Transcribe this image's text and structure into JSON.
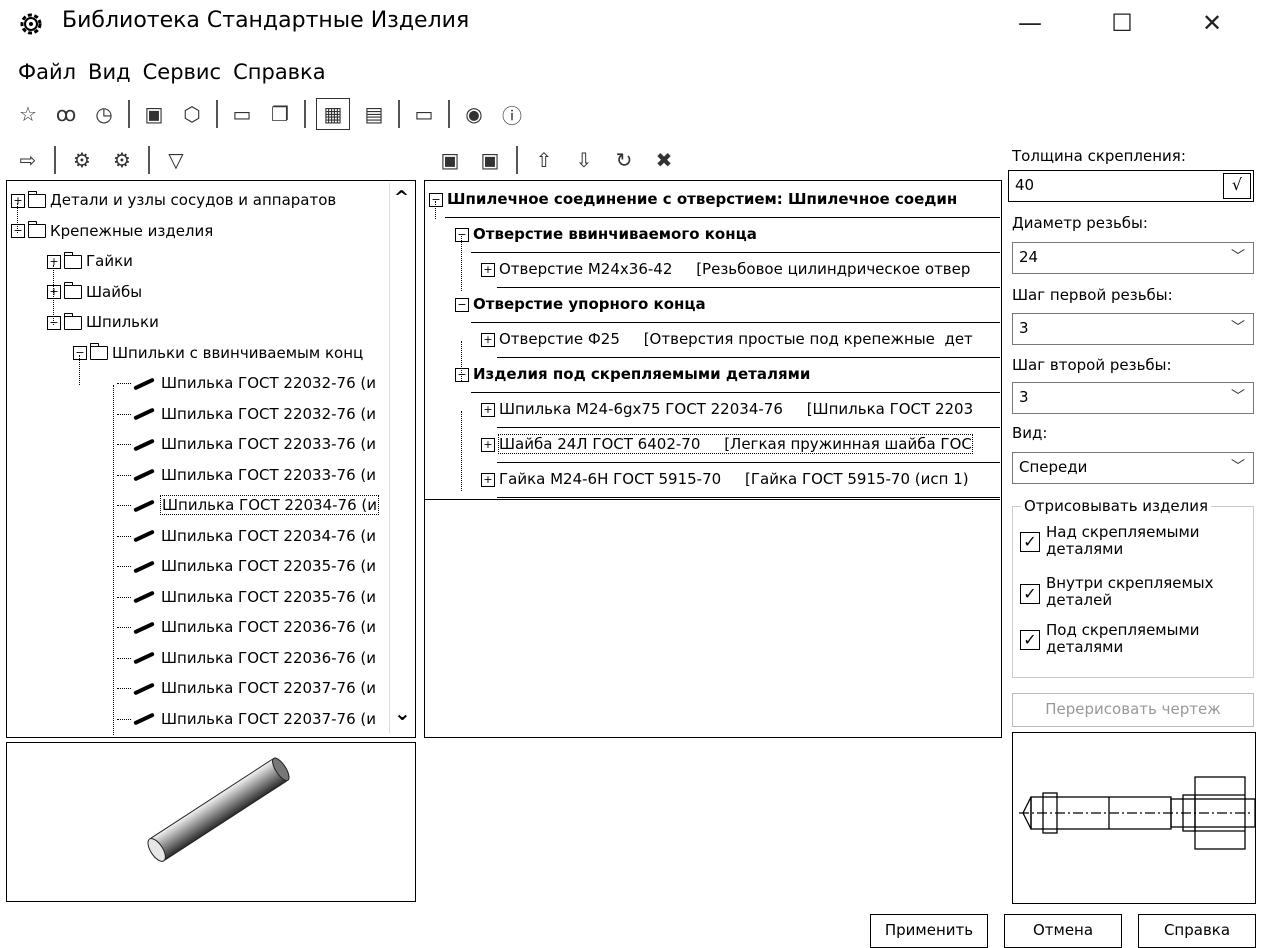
{
  "window": {
    "title": "Библиотека Стандартные Изделия",
    "minimize": "—",
    "maximize": "☐",
    "close": "✕"
  },
  "menu": [
    "Файл",
    "Вид",
    "Сервис",
    "Справка"
  ],
  "left_tree": {
    "items": [
      {
        "label": "Детали и узлы сосудов и аппаратов",
        "expander": "+",
        "level": 0
      },
      {
        "label": "Крепежные изделия",
        "expander": "−",
        "level": 0
      },
      {
        "label": "Гайки",
        "expander": "+",
        "level": 1
      },
      {
        "label": "Шайбы",
        "expander": "+",
        "level": 1
      },
      {
        "label": "Шпильки",
        "expander": "−",
        "level": 1
      },
      {
        "label": "Шпильки с ввинчиваемым конц",
        "expander": "−",
        "level": 2
      },
      {
        "label": "Шпилька ГОСТ 22032-76 (и"
      },
      {
        "label": "Шпилька ГОСТ 22032-76 (и"
      },
      {
        "label": "Шпилька ГОСТ 22033-76 (и"
      },
      {
        "label": "Шпилька ГОСТ 22033-76 (и"
      },
      {
        "label": "Шпилька ГОСТ 22034-76 (и",
        "selected": true
      },
      {
        "label": "Шпилька ГОСТ 22034-76 (и"
      },
      {
        "label": "Шпилька ГОСТ 22035-76 (и"
      },
      {
        "label": "Шпилька ГОСТ 22035-76 (и"
      },
      {
        "label": "Шпилька ГОСТ 22036-76 (и"
      },
      {
        "label": "Шпилька ГОСТ 22036-76 (и"
      },
      {
        "label": "Шпилька ГОСТ 22037-76 (и"
      },
      {
        "label": "Шпилька ГОСТ 22037-76 (и"
      }
    ],
    "scroll_up": "^",
    "scroll_down": "⌄"
  },
  "middle_tree": {
    "rows": [
      {
        "text": "Шпилечное соединение с отверстием: Шпилечное соедин",
        "bold": true,
        "expander": "−",
        "indent": 0
      },
      {
        "text": "Отверстие ввинчиваемого конца",
        "bold": true,
        "expander": "−",
        "indent": 1
      },
      {
        "text": "Отверстие М24х36-42     [Резьбовое цилиндрическое отвер",
        "bold": false,
        "expander": "+",
        "indent": 2
      },
      {
        "text": "Отверстие упорного конца",
        "bold": true,
        "expander": "−",
        "indent": 1
      },
      {
        "text": "Отверстие Ф25     [Отверстия простые под крепежные  дет",
        "bold": false,
        "expander": "+",
        "indent": 2
      },
      {
        "text": "Изделия под скрепляемыми деталями",
        "bold": true,
        "expander": "−",
        "indent": 1
      },
      {
        "text": "Шпилька М24-6gx75 ГОСТ 22034-76     [Шпилька ГОСТ 2203",
        "bold": false,
        "expander": "+",
        "indent": 2
      },
      {
        "text": "Шайба 24Л ГОСТ 6402-70     [Легкая пружинная шайба ГОС",
        "bold": false,
        "expander": "+",
        "indent": 2,
        "focused": true
      },
      {
        "text": "Гайка М24-6Н ГОСТ 5915-70     [Гайка ГОСТ 5915-70 (исп 1)",
        "bold": false,
        "expander": "+",
        "indent": 2
      }
    ]
  },
  "params": {
    "thickness_label": "Толщина скрепления:",
    "thickness_value": "40",
    "thickness_apply": "√",
    "diameter_label": "Диаметр резьбы:",
    "diameter_value": "24",
    "pitch1_label": "Шаг первой резьбы:",
    "pitch1_value": "3",
    "pitch2_label": "Шаг второй резьбы:",
    "pitch2_value": "3",
    "view_label": "Вид:",
    "view_value": "Спереди",
    "draw_group": "Отрисовывать изделия",
    "cb1_line1": "Над скрепляемыми",
    "cb1_line2": "деталями",
    "cb2_line1": "Внутри скрепляемых",
    "cb2_line2": "деталей",
    "cb3_line1": "Под скрепляемыми",
    "cb3_line2": "деталями",
    "checkmark": "✓",
    "redraw": "Перерисовать чертеж"
  },
  "buttons": {
    "apply": "Применить",
    "cancel": "Отмена",
    "help": "Справка"
  }
}
